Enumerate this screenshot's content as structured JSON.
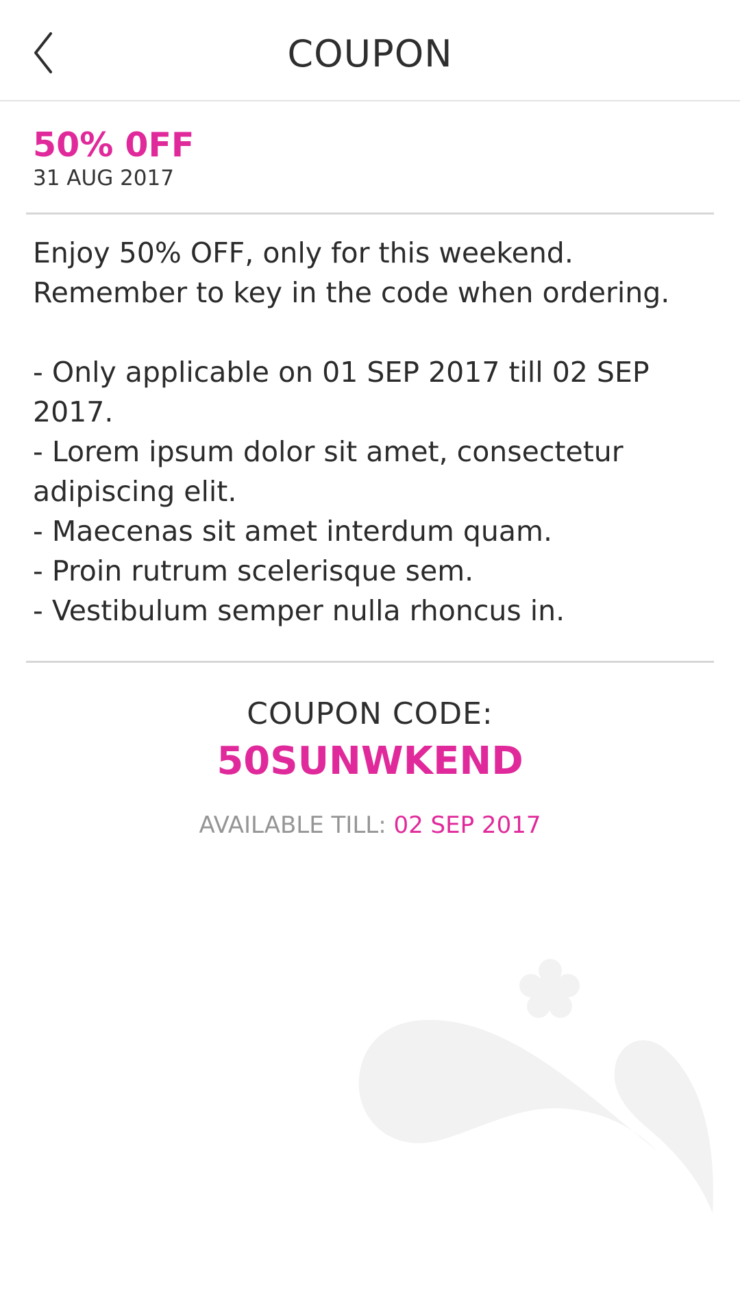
{
  "header": {
    "title": "COUPON",
    "back_icon": "chevron-left-icon"
  },
  "offer": {
    "title": "50% 0FF",
    "date": "31 AUG 2017"
  },
  "description": {
    "intro": [
      "Enjoy 50% OFF, only for this weekend.",
      "Remember to key in the code when ordering."
    ],
    "terms": [
      "- Only applicable on 01 SEP 2017 till 02 SEP 2017.",
      "- Lorem ipsum dolor sit amet, consectetur adipiscing elit.",
      "- Maecenas sit amet interdum quam.",
      "- Proin rutrum scelerisque sem.",
      "- Vestibulum semper nulla rhoncus in."
    ]
  },
  "coupon": {
    "code_label": "COUPON CODE:",
    "code": "50SUNWKEND",
    "available_label": "AVAILABLE TILL:",
    "available_date": "02 SEP 2017"
  },
  "colors": {
    "accent": "#e0299a",
    "text": "#2b2b2b",
    "muted": "#959595",
    "divider": "#d6d6d6",
    "watermark": "#f2f2f2"
  },
  "watermark_icon": "brand-watermark-icon"
}
